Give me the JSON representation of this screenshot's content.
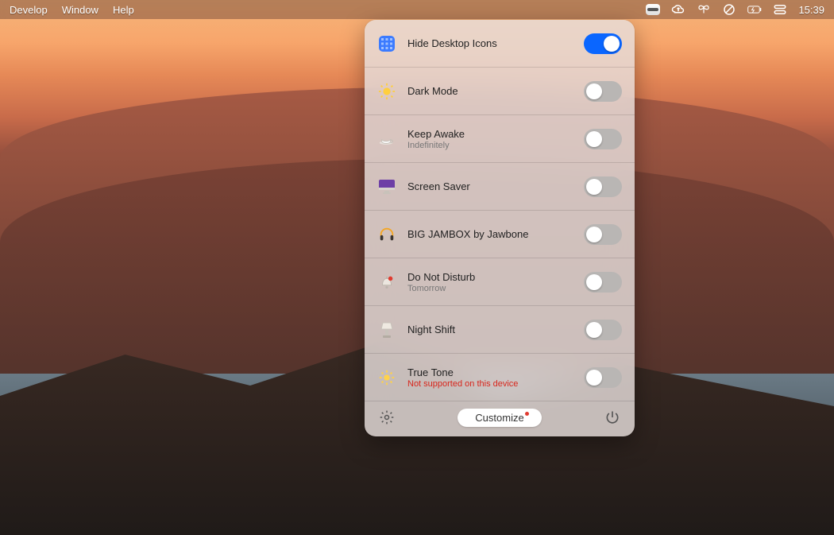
{
  "menubar": {
    "items": [
      "Develop",
      "Window",
      "Help"
    ],
    "clock": "15:39"
  },
  "panel": {
    "rows": [
      {
        "id": "hide-desktop",
        "title": "Hide Desktop Icons",
        "sub": "",
        "on": true,
        "icon": "grid",
        "err": false
      },
      {
        "id": "dark-mode",
        "title": "Dark Mode",
        "sub": "",
        "on": false,
        "icon": "sun",
        "err": false
      },
      {
        "id": "keep-awake",
        "title": "Keep Awake",
        "sub": "Indefinitely",
        "on": false,
        "icon": "coffee",
        "err": false
      },
      {
        "id": "screen-saver",
        "title": "Screen Saver",
        "sub": "",
        "on": false,
        "icon": "monitor",
        "err": false
      },
      {
        "id": "big-jambox",
        "title": "BIG JAMBOX by Jawbone",
        "sub": "",
        "on": false,
        "icon": "headphones",
        "err": false
      },
      {
        "id": "dnd",
        "title": "Do Not Disturb",
        "sub": "Tomorrow",
        "on": false,
        "icon": "bell",
        "err": false
      },
      {
        "id": "night-shift",
        "title": "Night Shift",
        "sub": "",
        "on": false,
        "icon": "lamp",
        "err": false
      },
      {
        "id": "true-tone",
        "title": "True Tone",
        "sub": "Not supported on this device",
        "on": false,
        "icon": "brightness",
        "err": true
      }
    ],
    "customize_label": "Customize"
  },
  "icons": {
    "menubar_right": [
      "app-switch",
      "cloud",
      "butterfly",
      "circle-slash",
      "battery",
      "tray"
    ]
  }
}
